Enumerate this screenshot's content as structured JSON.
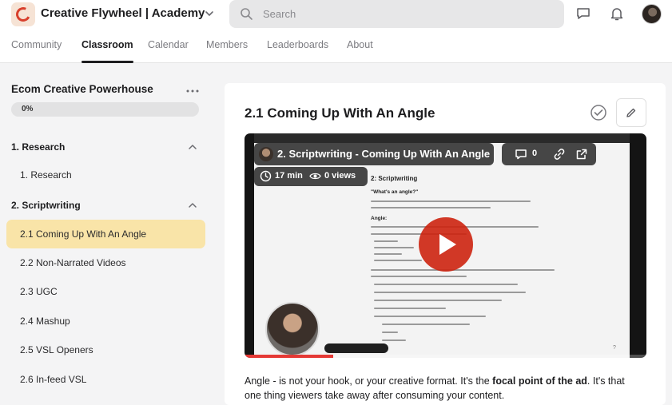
{
  "header": {
    "group_name": "Creative Flywheel | Academy",
    "search_placeholder": "Search",
    "accent": "#d8402d"
  },
  "nav_tabs": [
    {
      "label": "Community",
      "active": false
    },
    {
      "label": "Classroom",
      "active": true
    },
    {
      "label": "Calendar",
      "active": false
    },
    {
      "label": "Members",
      "active": false
    },
    {
      "label": "Leaderboards",
      "active": false
    },
    {
      "label": "About",
      "active": false
    }
  ],
  "sidebar": {
    "course_title": "Ecom Creative Powerhouse",
    "progress_label": "0%",
    "progress_value": 0.0,
    "sections": [
      {
        "label": "1. Research",
        "expanded": true,
        "lessons": [
          {
            "label": "1. Research",
            "active": false
          }
        ]
      },
      {
        "label": "2. Scriptwriting",
        "expanded": true,
        "lessons": [
          {
            "label": "2.1 Coming Up With An Angle",
            "active": true
          },
          {
            "label": "2.2 Non-Narrated Videos",
            "active": false
          },
          {
            "label": "2.3 UGC",
            "active": false
          },
          {
            "label": "2.4 Mashup",
            "active": false
          },
          {
            "label": "2.5 VSL Openers",
            "active": false
          },
          {
            "label": "2.6 In-feed VSL",
            "active": false
          }
        ]
      }
    ]
  },
  "main": {
    "lesson_title": "2.1 Coming Up With An Angle",
    "video": {
      "title": "2. Scriptwriting - Coming Up With An Angle",
      "comments": "0",
      "duration": "17 min",
      "views": "0 views",
      "doc_heading": "2: Scriptwriting",
      "doc_question": "\"What's an angle?\"",
      "doc_section": "Angle:",
      "progress": 0.22
    },
    "description": {
      "part1": "Angle - is not your hook, or your creative format. It's the ",
      "bold": "focal point of the ad",
      "part2": ". It's that one thing viewers take away after consuming your content."
    }
  }
}
